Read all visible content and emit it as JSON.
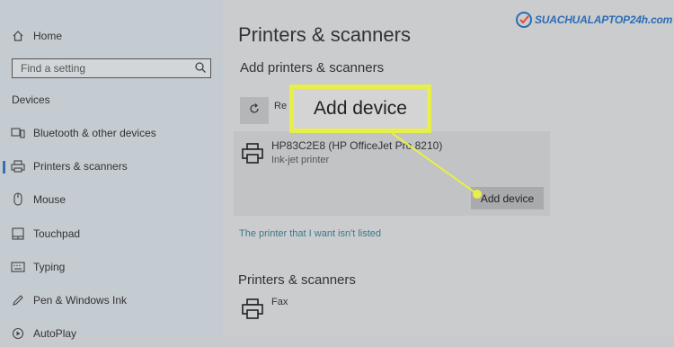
{
  "sidebar": {
    "home_label": "Home",
    "search_placeholder": "Find a setting",
    "section_title": "Devices",
    "items": [
      {
        "label": "Bluetooth & other devices",
        "icon": "bluetooth-devices-icon"
      },
      {
        "label": "Printers & scanners",
        "icon": "printer-icon",
        "selected": true
      },
      {
        "label": "Mouse",
        "icon": "mouse-icon"
      },
      {
        "label": "Touchpad",
        "icon": "touchpad-icon"
      },
      {
        "label": "Typing",
        "icon": "keyboard-icon"
      },
      {
        "label": "Pen & Windows Ink",
        "icon": "pen-icon"
      },
      {
        "label": "AutoPlay",
        "icon": "autoplay-icon"
      }
    ]
  },
  "main": {
    "page_title": "Printers & scanners",
    "add_section_title": "Add printers & scanners",
    "refresh_label": "Re",
    "device": {
      "name": "HP83C2E8 (HP OfficeJet Pro 8210)",
      "type": "Ink-jet printer",
      "add_button": "Add device"
    },
    "not_listed_link": "The printer that I want isn't listed",
    "list_section_title": "Printers & scanners",
    "fax_label": "Fax"
  },
  "callout": {
    "label": "Add device",
    "color": "#e8ef48"
  },
  "logo": {
    "text": "SUACHUALAPTOP24h.com",
    "color": "#2b6cb5"
  }
}
